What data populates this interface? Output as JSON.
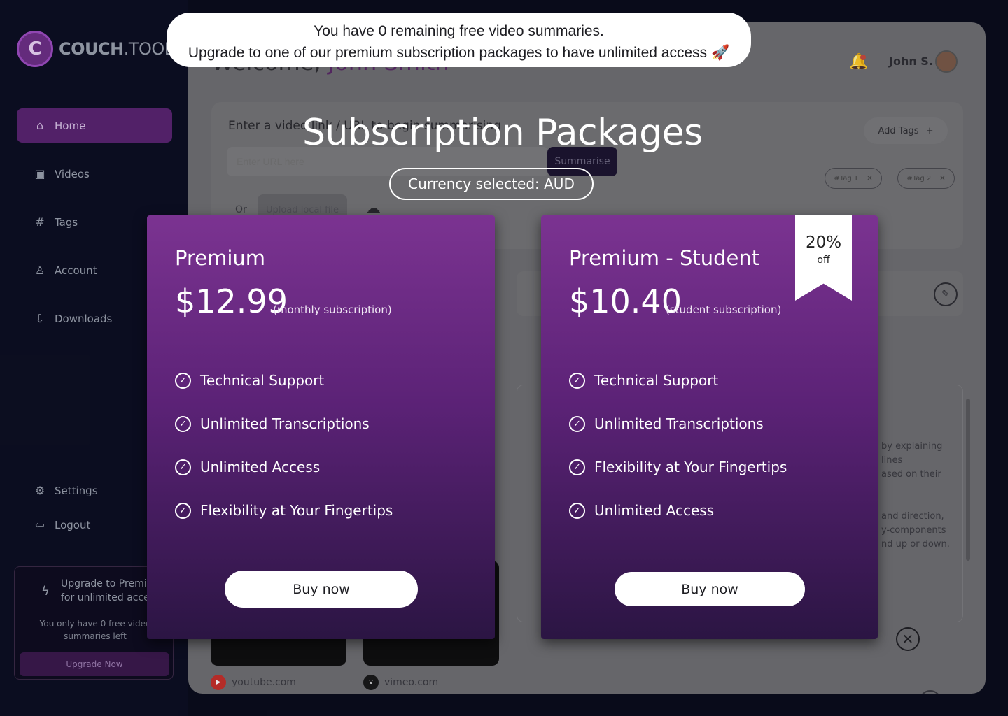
{
  "app": {
    "logo_text_bold": "COUCH",
    "logo_text_light": ".TOOLS",
    "logo_icon": "couch-tools-logo-icon"
  },
  "sidebar": {
    "items": [
      {
        "label": "Home",
        "icon": "home-icon",
        "active": true
      },
      {
        "label": "Videos",
        "icon": "calendar-video-icon",
        "active": false
      },
      {
        "label": "Tags",
        "icon": "hash-icon",
        "active": false
      },
      {
        "label": "Account",
        "icon": "user-icon",
        "active": false
      },
      {
        "label": "Downloads",
        "icon": "download-box-icon",
        "active": false
      },
      {
        "label": "Settings",
        "icon": "gear-icon",
        "active": false
      },
      {
        "label": "Logout",
        "icon": "logout-icon",
        "active": false
      }
    ],
    "upgrade": {
      "title": "Upgrade to Premium for unlimited access",
      "subtitle": "You only have 0 free video summaries left",
      "button": "Upgrade Now"
    }
  },
  "header": {
    "welcome_prefix": "Welcome,",
    "welcome_name": "John Smith",
    "user_short": "John S."
  },
  "input_card": {
    "label": "Enter a video link / URL to begin summarising",
    "url_placeholder": "Enter URL here",
    "summarise_button": "Summarise",
    "or_text": "Or",
    "upload_button": "Upload local file",
    "add_tags_button": "Add Tags",
    "tags": [
      "#Tag 1",
      "#Tag 2"
    ]
  },
  "summary": {
    "visible_fragments": [
      "by explaining",
      "lines",
      "ased on their",
      "and direction,",
      "y-components",
      "nd up or down."
    ]
  },
  "videos": [
    {
      "source": "youtube.com",
      "color": "#c4302b"
    },
    {
      "source": "vimeo.com",
      "color": "#1a1a1a"
    }
  ],
  "toast": {
    "line1": "You have 0 remaining free video summaries.",
    "line2": "Upgrade to one of our premium subscription packages to have unlimited access 🚀"
  },
  "modal": {
    "title": "Subscription Packages",
    "currency_label": "Currency selected: AUD",
    "plans": [
      {
        "name": "Premium",
        "price": "$12.99",
        "note": "(monthly subscription)",
        "features": [
          "Technical Support",
          "Unlimited Transcriptions",
          "Unlimited Access",
          "Flexibility at Your Fingertips"
        ],
        "button": "Buy now"
      },
      {
        "name": "Premium - Student",
        "price": "$10.40",
        "note": "(student subscription)",
        "features": [
          "Technical Support",
          "Unlimited Transcriptions",
          "Flexibility at Your Fingertips",
          "Unlimited Access"
        ],
        "button": "Buy now",
        "ribbon_percent": "20%",
        "ribbon_label": "off"
      }
    ],
    "close_icon": "close-circle-icon"
  },
  "colors": {
    "brand": "#7b3391",
    "card_gradient_end": "#2b1543",
    "sidebar_active": "#5a2470"
  }
}
